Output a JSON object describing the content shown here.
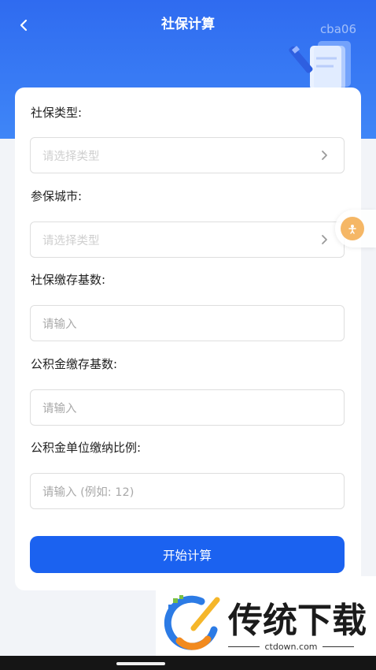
{
  "header": {
    "title": "社保计算",
    "watermark": "cba06"
  },
  "form": {
    "fields": [
      {
        "label": "社保类型:",
        "placeholder": "请选择类型"
      },
      {
        "label": "参保城市:",
        "placeholder": "请选择类型"
      },
      {
        "label": "社保缴存基数:",
        "placeholder": "请输入"
      },
      {
        "label": "公积金缴存基数:",
        "placeholder": "请输入"
      },
      {
        "label": "公积金单位缴纳比例:",
        "placeholder": "请输入 (例如: 12)"
      }
    ],
    "submit_label": "开始计算"
  },
  "branding": {
    "logo_text": "传统下载",
    "logo_domain": "ctdown.com"
  },
  "colors": {
    "header_blue": "#2f6bf0",
    "button_blue": "#1b62f0",
    "float_orange": "#f5b766"
  }
}
